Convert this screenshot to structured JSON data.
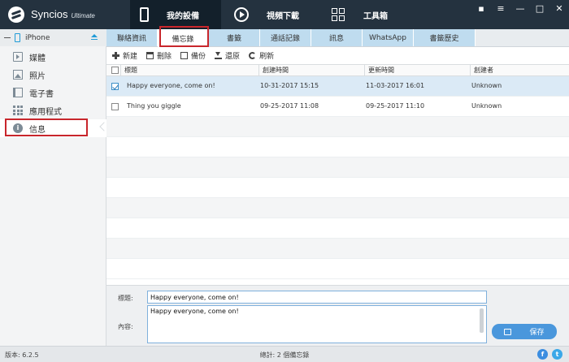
{
  "app": {
    "name": "Syncios",
    "edition": "Ultimate"
  },
  "nav": {
    "tabs": [
      {
        "label": "我的設備",
        "icon": "phone-icon",
        "active": true
      },
      {
        "label": "視頻下載",
        "icon": "play-icon",
        "active": false
      },
      {
        "label": "工具箱",
        "icon": "toolbox-icon",
        "active": false
      }
    ]
  },
  "window": {
    "controls": [
      "feedback-icon",
      "menu-icon",
      "minimize-icon",
      "maximize-icon",
      "close-icon"
    ]
  },
  "sidebar": {
    "device": "iPhone",
    "items": [
      {
        "label": "媒體",
        "icon": "media-icon"
      },
      {
        "label": "照片",
        "icon": "photo-icon"
      },
      {
        "label": "電子書",
        "icon": "ebook-icon"
      },
      {
        "label": "應用程式",
        "icon": "apps-icon"
      },
      {
        "label": "信息",
        "icon": "info-icon",
        "active": true
      }
    ]
  },
  "tabs": [
    {
      "label": "聯絡資訊"
    },
    {
      "label": "備忘錄",
      "active": true
    },
    {
      "label": "書籤"
    },
    {
      "label": "通話記錄"
    },
    {
      "label": "訊息"
    },
    {
      "label": "WhatsApp"
    },
    {
      "label": "書籤歷史"
    }
  ],
  "toolbar": {
    "new": "新建",
    "delete": "刪除",
    "backup": "備份",
    "restore": "還原",
    "refresh": "刷新"
  },
  "table": {
    "columns": [
      "標題",
      "創建時間",
      "更新時間",
      "創建者"
    ],
    "rows": [
      {
        "checked": true,
        "title": "Happy everyone, come on!",
        "created": "10-31-2017 15:15",
        "updated": "11-03-2017 16:01",
        "creator": "Unknown"
      },
      {
        "checked": false,
        "title": "Thing you giggle",
        "created": "09-25-2017 11:08",
        "updated": "09-25-2017 11:10",
        "creator": "Unknown"
      }
    ]
  },
  "editor": {
    "title_label": "標題:",
    "title_value": "Happy everyone, come on!",
    "content_label": "內容:",
    "content_value": "Happy everyone, come on!",
    "save_label": "保存"
  },
  "status": {
    "version": "版本: 6.2.5",
    "summary": "總計: 2 個備忘錄"
  },
  "colors": {
    "titlebar": "#24323f",
    "accent": "#4a97dc",
    "highlight": "#c8262c",
    "tab": "#bfdcef"
  }
}
